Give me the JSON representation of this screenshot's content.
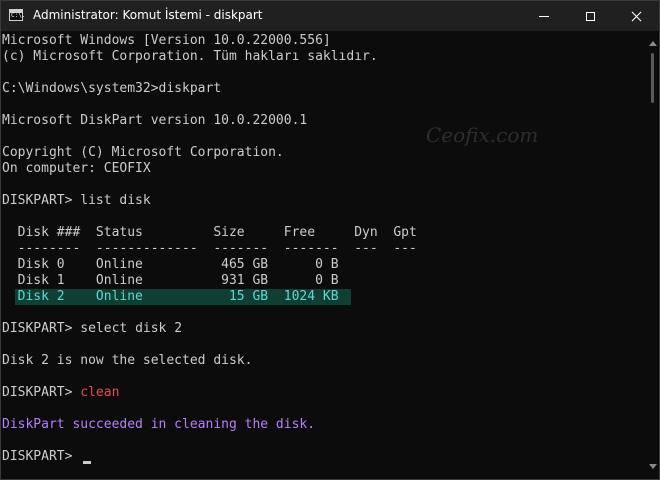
{
  "window": {
    "title": "Administrator: Komut İstemi - diskpart",
    "icon_text": "C:\\."
  },
  "watermark": "Ceofix.com",
  "console": {
    "lines": [
      "Microsoft Windows [Version 10.0.22000.556]",
      "(c) Microsoft Corporation. Tüm hakları saklıdır.",
      "",
      "C:\\Windows\\system32>diskpart",
      "",
      "Microsoft DiskPart version 10.0.22000.1",
      "",
      "Copyright (C) Microsoft Corporation.",
      "On computer: CEOFIX",
      "",
      "DISKPART> list disk",
      "",
      "  Disk ###  Status         Size     Free     Dyn  Gpt",
      "  --------  -------------  -------  -------  ---  ---",
      "  Disk 0    Online          465 GB      0 B",
      "  Disk 1    Online          931 GB      0 B",
      "",
      "",
      "DISKPART> ",
      "",
      "Disk 2 is now the selected disk.",
      "",
      "DISKPART> ",
      "",
      "",
      "",
      "DISKPART> "
    ],
    "selected_row": "  Disk 2    Online           15 GB  1024 KB",
    "select_command": "select disk 2",
    "clean_command": "clean",
    "success_message": "DiskPart succeeded in cleaning the disk."
  },
  "colors": {
    "background": "#0c0c0c",
    "text": "#cccccc",
    "clean": "#e74856",
    "success": "#b47fff",
    "selected": "#61d6d6",
    "selected_bg": "#0f3f33"
  }
}
